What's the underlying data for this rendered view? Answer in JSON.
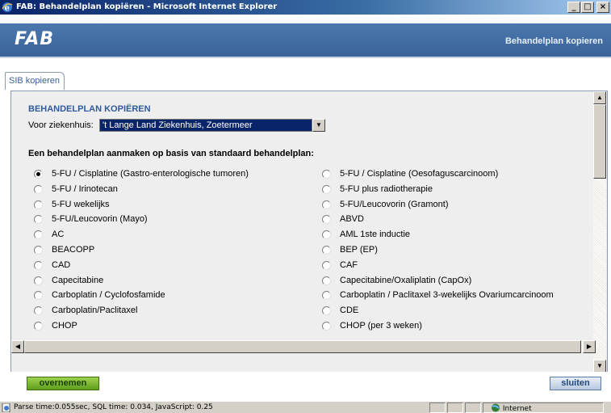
{
  "window": {
    "title": "FAB: Behandelplan kopiëren - Microsoft Internet Explorer",
    "buttons": [
      "_",
      "□",
      "×"
    ]
  },
  "header": {
    "logo": "FAB",
    "title": "Behandelplan kopieren"
  },
  "tab": {
    "label": "SIB kopieren"
  },
  "form": {
    "section_title": "BEHANDELPLAN KOPIËREN",
    "hospital_label": "Voor ziekenhuis:",
    "hospital_value": "'t Lange Land Ziekenhuis, Zoetermeer",
    "question": "Een behandelplan aanmaken op basis van standaard behandelplan:"
  },
  "options": {
    "left": [
      {
        "label": "5-FU / Cisplatine (Gastro-enterologische tumoren)",
        "selected": true
      },
      {
        "label": "5-FU / Irinotecan",
        "selected": false
      },
      {
        "label": "5-FU wekelijks",
        "selected": false
      },
      {
        "label": "5-FU/Leucovorin (Mayo)",
        "selected": false
      },
      {
        "label": "AC",
        "selected": false
      },
      {
        "label": "BEACOPP",
        "selected": false
      },
      {
        "label": "CAD",
        "selected": false
      },
      {
        "label": "Capecitabine",
        "selected": false
      },
      {
        "label": "Carboplatin / Cyclofosfamide",
        "selected": false
      },
      {
        "label": "Carboplatin/Paclitaxel",
        "selected": false
      },
      {
        "label": "CHOP",
        "selected": false
      }
    ],
    "right": [
      {
        "label": "5-FU / Cisplatine (Oesofaguscarcinoom)",
        "selected": false
      },
      {
        "label": "5-FU plus radiotherapie",
        "selected": false
      },
      {
        "label": "5-FU/Leucovorin (Gramont)",
        "selected": false
      },
      {
        "label": "ABVD",
        "selected": false
      },
      {
        "label": "AML 1ste inductie",
        "selected": false
      },
      {
        "label": "BEP (EP)",
        "selected": false
      },
      {
        "label": "CAF",
        "selected": false
      },
      {
        "label": "Capecitabine/Oxaliplatin (CapOx)",
        "selected": false
      },
      {
        "label": "Carboplatin / Paclitaxel 3-wekelijks Ovariumcarcinoom",
        "selected": false
      },
      {
        "label": "CDE",
        "selected": false
      },
      {
        "label": "CHOP (per 3 weken)",
        "selected": false
      }
    ]
  },
  "actions": {
    "confirm": "overnemen",
    "close": "sluiten"
  },
  "statusbar": {
    "text": "Parse time:0.055sec, SQL time: 0.034, JavaScript: 0.25",
    "zone": "Internet"
  },
  "colors": {
    "brand": "#3a6399",
    "confirm": "#5f9e1c",
    "selection": "#0a246a"
  }
}
